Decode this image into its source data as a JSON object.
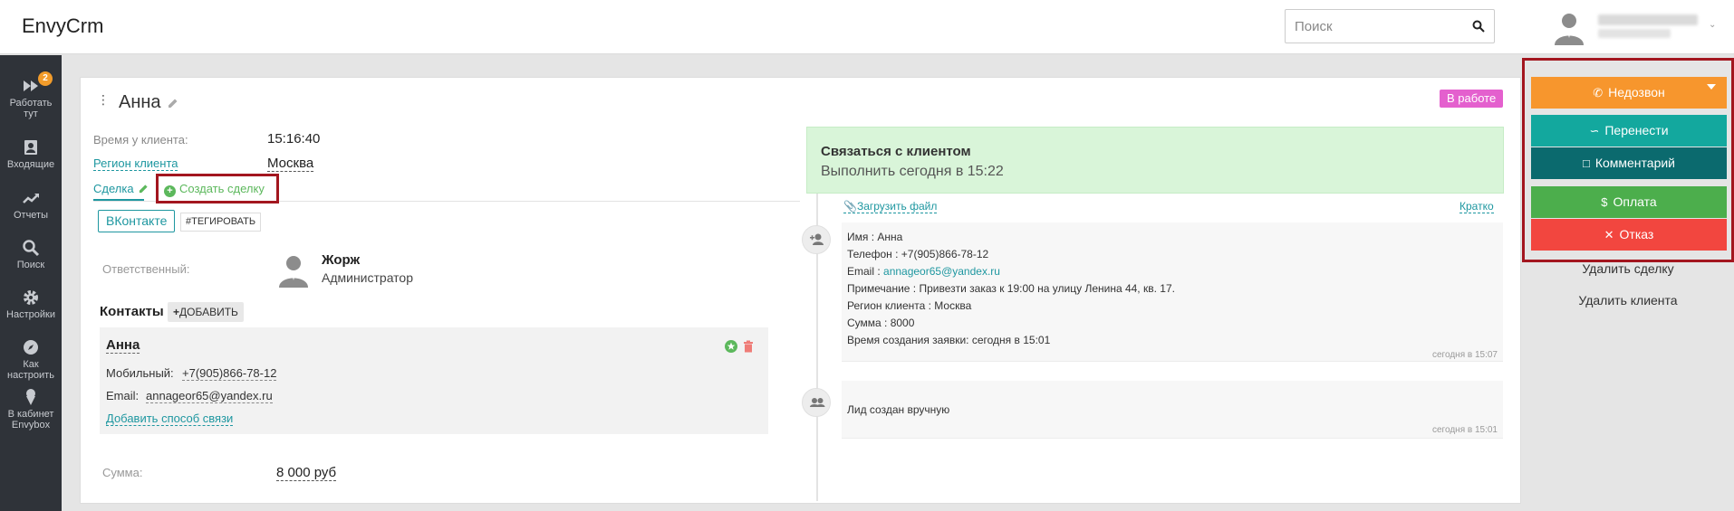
{
  "app": {
    "title": "EnvyCrm"
  },
  "search": {
    "placeholder": "Поиск"
  },
  "sidebar": {
    "items": [
      {
        "label1": "Работать",
        "label2": "тут",
        "badge": "2",
        "icon": "fast-forward-icon"
      },
      {
        "label1": "Входящие",
        "label2": "",
        "icon": "inbox-icon"
      },
      {
        "label1": "Отчеты",
        "label2": "",
        "icon": "trend-icon"
      },
      {
        "label1": "Поиск",
        "label2": "",
        "icon": "search-icon"
      },
      {
        "label1": "Настройки",
        "label2": "",
        "icon": "gear-icon"
      },
      {
        "label1": "Как",
        "label2": "настроить",
        "icon": "compass-icon"
      },
      {
        "label1": "В кабинет",
        "label2": "Envybox",
        "icon": "ice-cream-icon"
      }
    ]
  },
  "lead": {
    "name": "Анна",
    "status": "В работе",
    "time_label": "Время у клиента:",
    "time_value": "15:16:40",
    "region_label": "Регион клиента",
    "region_value": "Москва"
  },
  "tabs": {
    "deal": "Сделка",
    "create_deal": "Создать сделку"
  },
  "buttons": {
    "vk": "ВКонтакте",
    "tag": "#ТЕГИРОВАТЬ",
    "add": "ДОБАВИТЬ"
  },
  "responsible": {
    "label": "Ответственный:",
    "name": "Жорж",
    "role": "Администратор"
  },
  "contacts": {
    "title": "Контакты",
    "name": "Анна",
    "mobile_label": "Мобильный:",
    "mobile_value": "+7(905)866-78-12",
    "email_label": "Email:",
    "email_value": "annageor65@yandex.ru",
    "add_link": "Добавить способ связи"
  },
  "sum": {
    "label": "Сумма:",
    "value": "8 000 руб"
  },
  "task": {
    "title": "Связаться с клиентом",
    "subtitle": "Выполнить сегодня в 15:22"
  },
  "timeline": {
    "upload": "Загрузить файл",
    "brief": "Кратко",
    "events": [
      {
        "lines": [
          "Имя : Анна",
          "Телефон : +7(905)866-78-12",
          "Email : ",
          "Примечание : Привезти заказ к 19:00 на улицу Ленина 44, кв. 17.",
          "Регион клиента : Москва",
          "Сумма : 8000",
          "Время создания заявки: сегодня в 15:01"
        ],
        "email_link": "annageor65@yandex.ru",
        "time": "сегодня в 15:07"
      },
      {
        "lines": [
          "Лид создан вручную"
        ],
        "time": "сегодня в 15:01"
      }
    ]
  },
  "actions": {
    "no_answer": "Недозвон",
    "reschedule": "Перенести",
    "comment": "Комментарий",
    "payment": "Оплата",
    "refuse": "Отказ",
    "delete_deal": "Удалить сделку",
    "delete_client": "Удалить клиента",
    "colors": {
      "no_answer": "#f7962d",
      "reschedule": "#13a89e",
      "comment": "#0b6a6e",
      "payment": "#4cae4c",
      "refuse": "#f2463f"
    }
  }
}
